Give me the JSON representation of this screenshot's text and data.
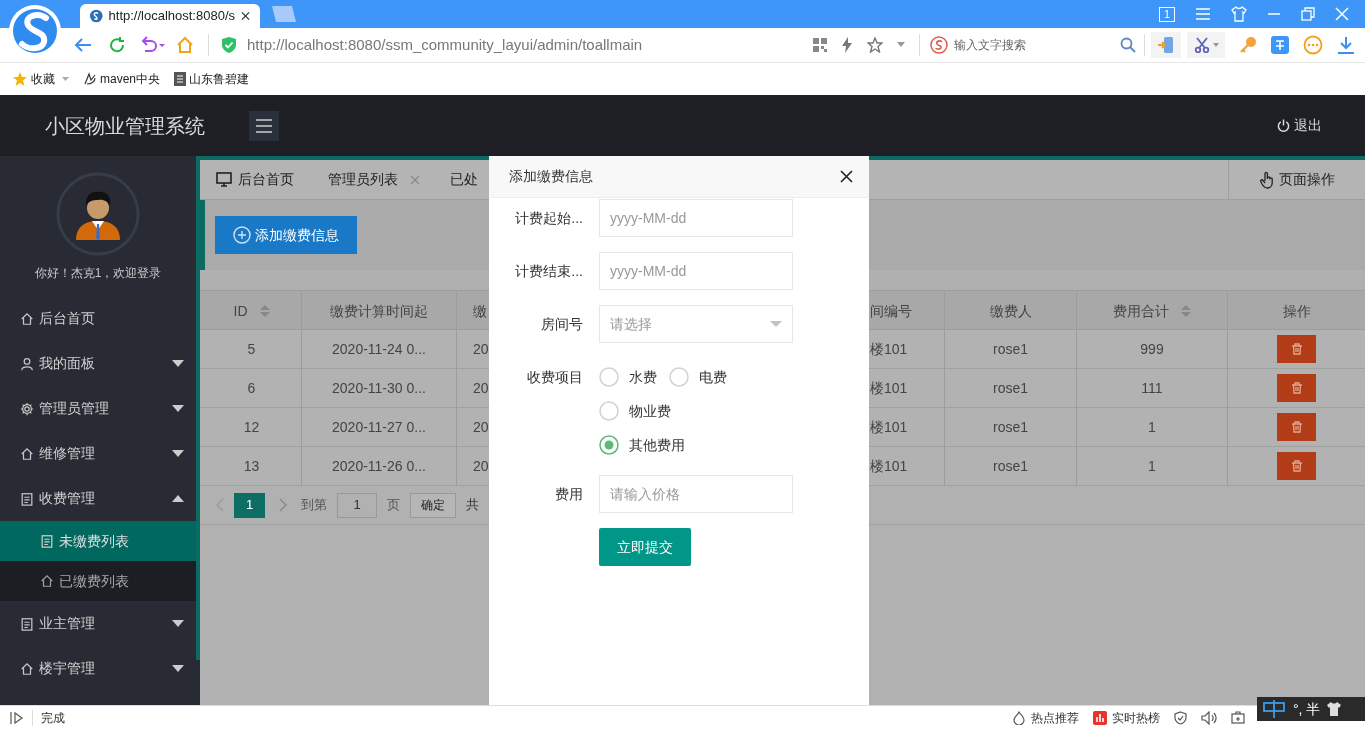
{
  "browser": {
    "tab_title": "http://localhost:8080/s",
    "tab_count": "1",
    "url": "http://localhost:8080/ssm_community_layui/admin/toallmain",
    "search_placeholder": "输入文字搜索",
    "bookmarks": [
      {
        "label": "收藏"
      },
      {
        "label": "maven中央"
      },
      {
        "label": "山东鲁碧建"
      }
    ]
  },
  "app": {
    "title": "小区物业管理系统",
    "logout": "退出"
  },
  "sidebar": {
    "greeting": "你好！杰克1，欢迎登录",
    "items": [
      {
        "label": "后台首页",
        "kind": "link"
      },
      {
        "label": "我的面板",
        "kind": "group",
        "expanded": false
      },
      {
        "label": "管理员管理",
        "kind": "group",
        "expanded": false
      },
      {
        "label": "维修管理",
        "kind": "group",
        "expanded": false
      },
      {
        "label": "收费管理",
        "kind": "group",
        "expanded": true,
        "children": [
          {
            "label": "未缴费列表",
            "selected": true
          },
          {
            "label": "已缴费列表",
            "selected": false
          }
        ]
      },
      {
        "label": "业主管理",
        "kind": "group",
        "expanded": false
      },
      {
        "label": "楼宇管理",
        "kind": "group",
        "expanded": false
      }
    ]
  },
  "tabs": [
    {
      "label": "后台首页",
      "closable": false
    },
    {
      "label": "管理员列表",
      "closable": true
    },
    {
      "label": "已处",
      "closable": false
    }
  ],
  "page_actions": "页面操作",
  "add_button": "添加缴费信息",
  "table": {
    "columns": [
      {
        "label": "ID",
        "sortable": true
      },
      {
        "label": "缴费计算时间起",
        "sortable": false
      },
      {
        "label": "缴",
        "sortable": false
      },
      {
        "label": "间编号",
        "sortable": false
      },
      {
        "label": "缴费人",
        "sortable": false
      },
      {
        "label": "费用合计",
        "sortable": true
      },
      {
        "label": "操作",
        "sortable": false
      }
    ],
    "rows": [
      {
        "cells": [
          "5",
          "2020-11-24 0...",
          "20",
          "楼101",
          "rose1",
          "999"
        ]
      },
      {
        "cells": [
          "6",
          "2020-11-30 0...",
          "20",
          "楼101",
          "rose1",
          "111"
        ]
      },
      {
        "cells": [
          "12",
          "2020-11-27 0...",
          "20",
          "楼101",
          "rose1",
          "1"
        ]
      },
      {
        "cells": [
          "13",
          "2020-11-26 0...",
          "20",
          "楼101",
          "rose1",
          "1"
        ]
      }
    ]
  },
  "pagination": {
    "current": "1",
    "goto_label": "到第",
    "goto_value": "1",
    "page_unit": "页",
    "confirm": "确定",
    "total": "共"
  },
  "dialog": {
    "title": "添加缴费信息",
    "fields": [
      {
        "kind": "text",
        "label": "计费起始...",
        "placeholder": "yyyy-MM-dd"
      },
      {
        "kind": "text",
        "label": "计费结束...",
        "placeholder": "yyyy-MM-dd"
      },
      {
        "kind": "select",
        "label": "房间号",
        "placeholder": "请选择"
      },
      {
        "kind": "radio",
        "label": "收费项目",
        "options": [
          {
            "label": "水费",
            "selected": false
          },
          {
            "label": "电费",
            "selected": false
          },
          {
            "label": "物业费",
            "selected": false
          },
          {
            "label": "其他费用",
            "selected": true
          }
        ]
      },
      {
        "kind": "text",
        "label": "费用",
        "placeholder": "请输入价格"
      }
    ],
    "submit": "立即提交"
  },
  "status_bar": {
    "status": "完成",
    "items": [
      {
        "label": "热点推荐"
      },
      {
        "label": "实时热榜"
      }
    ],
    "ime": "°, 半"
  }
}
